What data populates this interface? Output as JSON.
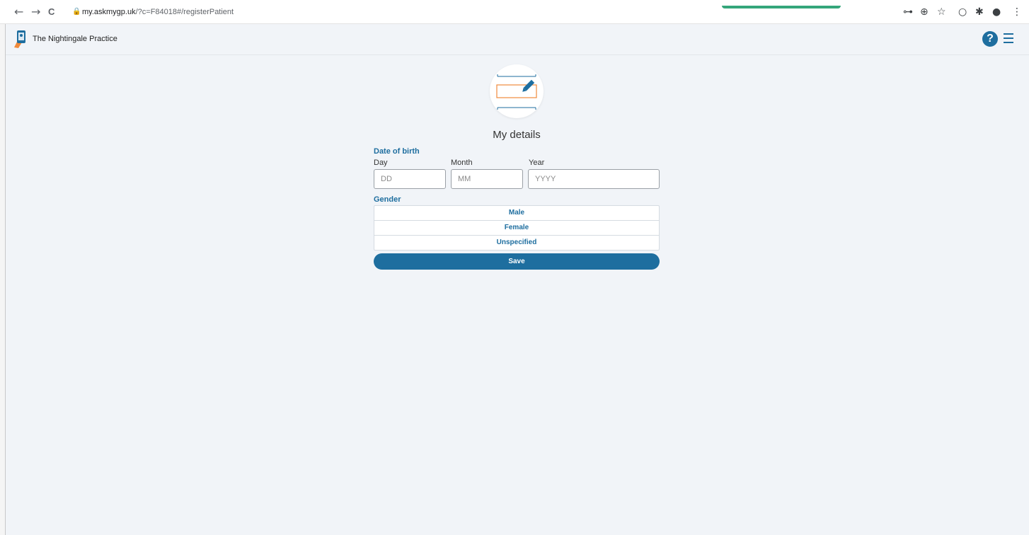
{
  "browser": {
    "url_host": "my.askmygp.uk",
    "url_rest": "/?c=F84018#/registerPatient",
    "back_icon": "←",
    "forward_icon": "→",
    "reload_icon": "C",
    "lock_icon": "🔒",
    "key_icon": "⊶",
    "install_icon": "⊕",
    "star_icon": "☆",
    "extension_icon": "○",
    "puzzle_icon": "✱",
    "profile_icon": "●",
    "kebab_icon": "⋮",
    "accent": "#35a67a"
  },
  "header": {
    "practice_name": "The Nightingale Practice",
    "help_label": "?"
  },
  "main": {
    "title": "My details",
    "dob": {
      "label": "Date of birth",
      "day_label": "Day",
      "day_placeholder": "DD",
      "month_label": "Month",
      "month_placeholder": "MM",
      "year_label": "Year",
      "year_placeholder": "YYYY"
    },
    "gender": {
      "label": "Gender",
      "options": [
        "Male",
        "Female",
        "Unspecified"
      ]
    },
    "save_label": "Save"
  },
  "colors": {
    "brand_blue": "#1e6e9f",
    "background": "#f1f4f8",
    "accent_orange": "#f08a3c"
  }
}
